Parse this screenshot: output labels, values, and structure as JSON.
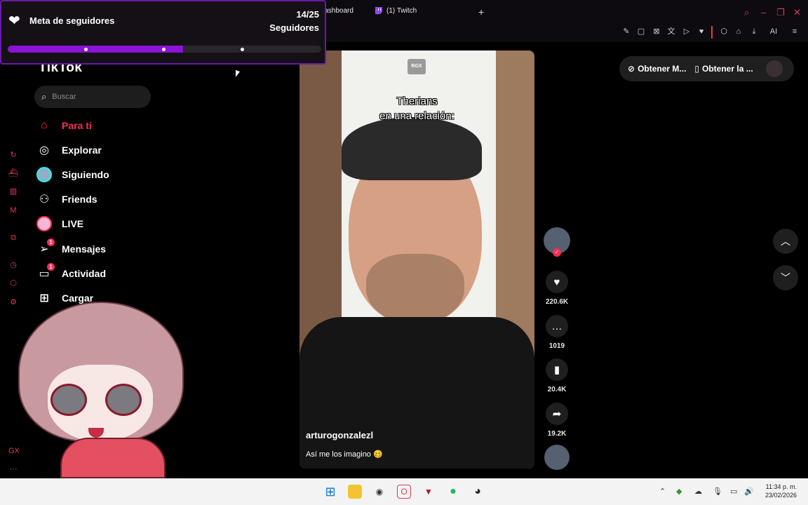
{
  "browser": {
    "tabs": [
      {
        "label": "Dashboard",
        "icon": "dashboard-icon"
      },
      {
        "label": "(1) Twitch",
        "icon": "twitch-icon"
      }
    ],
    "new_tab_icon": "plus-icon",
    "accent_color": "#e03b52",
    "toolbar_ai_label": "AI"
  },
  "follower_goal": {
    "title": "Meta de seguidores",
    "count": "14/25",
    "subtitle": "Seguidores",
    "progress": 0.56,
    "bar_color": "#8a13d6"
  },
  "tiktok": {
    "logo": "TikTok",
    "search_placeholder": "Buscar",
    "nav": [
      {
        "label": "Para ti",
        "icon": "home-icon",
        "active": true
      },
      {
        "label": "Explorar",
        "icon": "compass-icon"
      },
      {
        "label": "Siguiendo",
        "icon": "following-avatar-icon"
      },
      {
        "label": "Friends",
        "icon": "friends-icon"
      },
      {
        "label": "LIVE",
        "icon": "live-icon"
      },
      {
        "label": "Mensajes",
        "icon": "messages-icon",
        "badge": "1"
      },
      {
        "label": "Actividad",
        "icon": "activity-icon",
        "badge": "1"
      },
      {
        "label": "Cargar",
        "icon": "upload-icon"
      }
    ],
    "video": {
      "watermark": "RGX",
      "caption_line1": "Therians",
      "caption_line2": "en una relación:",
      "author": "arturogonzalezl",
      "description": "Así me los imagino 🥴"
    },
    "actions": {
      "likes": "220.6K",
      "comments": "1019",
      "saves": "20.4K",
      "shares": "19.2K"
    },
    "top_right": {
      "pill1": "Obtener M...",
      "pill2": "Obtener la ..."
    }
  },
  "taskbar": {
    "time": "11:34 p. m.",
    "date": "23/02/2026"
  }
}
